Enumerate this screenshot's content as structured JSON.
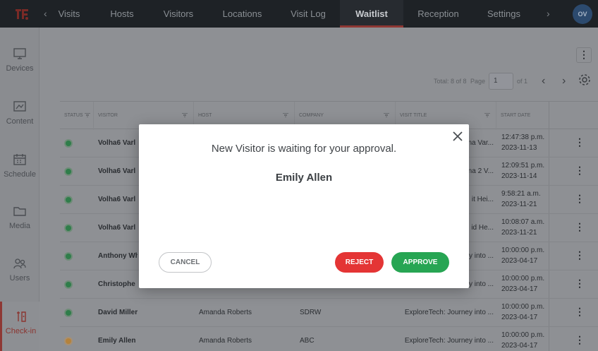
{
  "nav": {
    "items": [
      {
        "label": "Visits",
        "active": false
      },
      {
        "label": "Hosts",
        "active": false
      },
      {
        "label": "Visitors",
        "active": false
      },
      {
        "label": "Locations",
        "active": false
      },
      {
        "label": "Visit Log",
        "active": false
      },
      {
        "label": "Waitlist",
        "active": true
      },
      {
        "label": "Reception",
        "active": false
      },
      {
        "label": "Settings",
        "active": false
      }
    ],
    "prev_icon": "chevron-left-icon",
    "next_icon": "chevron-right-icon",
    "avatar_initials": "OV",
    "accent_color": "#c0392b"
  },
  "sidebar": {
    "items": [
      {
        "label": "Devices",
        "icon": "monitor-icon"
      },
      {
        "label": "Content",
        "icon": "content-icon"
      },
      {
        "label": "Schedule",
        "icon": "calendar-icon"
      },
      {
        "label": "Media",
        "icon": "folder-icon"
      },
      {
        "label": "Users",
        "icon": "users-icon"
      },
      {
        "label": "Check-in",
        "icon": "check-in-icon",
        "active": true
      }
    ]
  },
  "pagination": {
    "total_label": "Total: 8 of 8",
    "page_label": "Page",
    "page_value": "1",
    "of_label": "of 1"
  },
  "table": {
    "columns": [
      "Status",
      "Visitor",
      "Host",
      "Company",
      "Visit Title",
      "Start Date"
    ],
    "rows": [
      {
        "status": "approved",
        "visitor": "Volha6 Varl",
        "host": "",
        "company": "",
        "title": "na Var...",
        "time": "12:47:38 p.m.",
        "date": "2023-11-13"
      },
      {
        "status": "approved",
        "visitor": "Volha6 Varl",
        "host": "",
        "company": "",
        "title": "na 2 V...",
        "time": "12:09:51 p.m.",
        "date": "2023-11-14"
      },
      {
        "status": "approved",
        "visitor": "Volha6 Varl",
        "host": "",
        "company": "",
        "title": "it Hei...",
        "time": "9:58:21 a.m.",
        "date": "2023-11-21"
      },
      {
        "status": "approved",
        "visitor": "Volha6 Varl",
        "host": "",
        "company": "",
        "title": "id He...",
        "time": "10:08:07 a.m.",
        "date": "2023-11-21"
      },
      {
        "status": "approved",
        "visitor": "Anthony Wh",
        "host": "",
        "company": "",
        "title": "ey into ...",
        "time": "10:00:00 p.m.",
        "date": "2023-04-17"
      },
      {
        "status": "approved",
        "visitor": "Christophe",
        "host": "",
        "company": "",
        "title": "ey into ...",
        "time": "10:00:00 p.m.",
        "date": "2023-04-17"
      },
      {
        "status": "approved",
        "visitor": "David Miller",
        "host": "Amanda Roberts",
        "company": "SDRW",
        "title": "ExploreTech: Journey into ...",
        "time": "10:00:00 p.m.",
        "date": "2023-04-17"
      },
      {
        "status": "pending",
        "visitor": "Emily Allen",
        "host": "Amanda Roberts",
        "company": "ABC",
        "title": "ExploreTech: Journey into ...",
        "time": "10:00:00 p.m.",
        "date": "2023-04-17"
      }
    ]
  },
  "modal": {
    "message": "New Visitor is waiting for your approval.",
    "visitor_name": "Emily Allen",
    "cancel_label": "CANCEL",
    "reject_label": "REJECT",
    "approve_label": "APPROVE",
    "reject_color": "#e43535",
    "approve_color": "#27a553"
  }
}
